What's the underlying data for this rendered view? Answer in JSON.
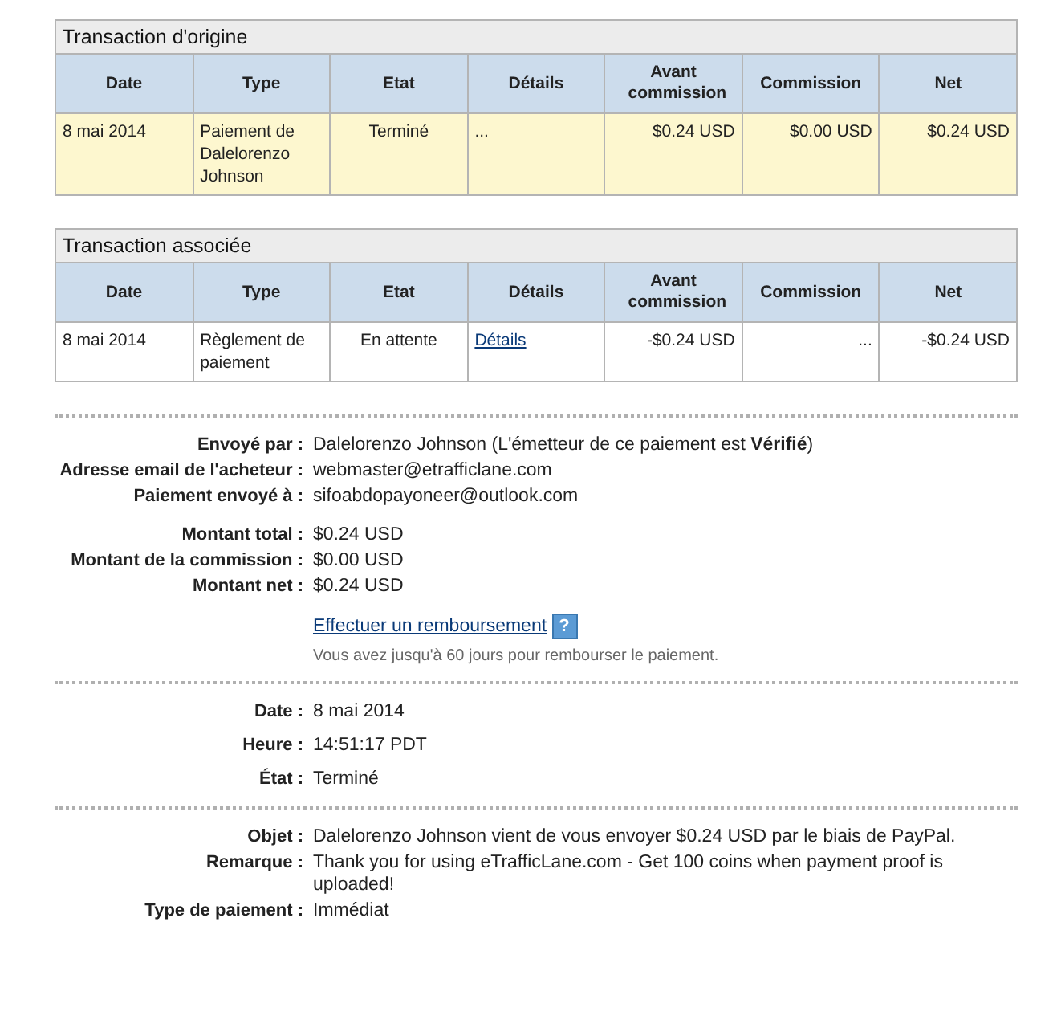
{
  "tables": [
    {
      "title": "Transaction d'origine",
      "columns": [
        "Date",
        "Type",
        "Etat",
        "Détails",
        "Avant commission",
        "Commission",
        "Net"
      ],
      "rows": [
        {
          "highlighted": true,
          "cells": [
            {
              "kind": "text",
              "text": "8 mai 2014"
            },
            {
              "kind": "text",
              "text": "Paiement de Dalelorenzo Johnson"
            },
            {
              "kind": "text",
              "text": "Terminé"
            },
            {
              "kind": "text",
              "text": "..."
            },
            {
              "kind": "text",
              "text": "$0.24 USD"
            },
            {
              "kind": "text",
              "text": "$0.00 USD"
            },
            {
              "kind": "text",
              "text": "$0.24 USD"
            }
          ]
        }
      ]
    },
    {
      "title": "Transaction associée",
      "columns": [
        "Date",
        "Type",
        "Etat",
        "Détails",
        "Avant commission",
        "Commission",
        "Net"
      ],
      "rows": [
        {
          "highlighted": false,
          "cells": [
            {
              "kind": "text",
              "text": "8 mai 2014"
            },
            {
              "kind": "text",
              "text": "Règlement de paiement"
            },
            {
              "kind": "text",
              "text": "En attente"
            },
            {
              "kind": "link",
              "text": "Détails"
            },
            {
              "kind": "text",
              "text": "-$0.24 USD"
            },
            {
              "kind": "text",
              "text": "..."
            },
            {
              "kind": "text",
              "text": "-$0.24 USD"
            }
          ]
        }
      ]
    }
  ],
  "sections": [
    {
      "groups": [
        [
          {
            "label": "Envoyé par :",
            "value": "Dalelorenzo Johnson (L'émetteur de ce paiement est **Vérifié**)"
          },
          {
            "label": "Adresse email de l'acheteur :",
            "value": "webmaster@etrafficlane.com"
          },
          {
            "label": "Paiement envoyé à :",
            "value": "sifoabdopayoneer@outlook.com"
          }
        ],
        [
          {
            "label": "Montant total :",
            "value": "$0.24 USD"
          },
          {
            "label": "Montant de la commission :",
            "value": "$0.00 USD"
          },
          {
            "label": "Montant net :",
            "value": "$0.24 USD"
          }
        ]
      ],
      "refund": {
        "link": "Effectuer un remboursement",
        "help": "?",
        "note": "Vous avez jusqu'à 60 jours pour rembourser le paiement."
      }
    },
    {
      "groups": [
        [
          {
            "label": "Date :",
            "value": "8 mai 2014"
          },
          {
            "label": "Heure :",
            "value": "14:51:17 PDT"
          },
          {
            "label": "État :",
            "value": "Terminé"
          }
        ]
      ]
    },
    {
      "groups": [
        [
          {
            "label": "Objet :",
            "value": "Dalelorenzo Johnson vient de vous envoyer $0.24 USD par le biais de PayPal."
          },
          {
            "label": "Remarque :",
            "value": "Thank you for using eTrafficLane.com - Get 100 coins when payment proof is uploaded!"
          },
          {
            "label": "Type de paiement :",
            "value": "Immédiat"
          }
        ]
      ]
    }
  ]
}
